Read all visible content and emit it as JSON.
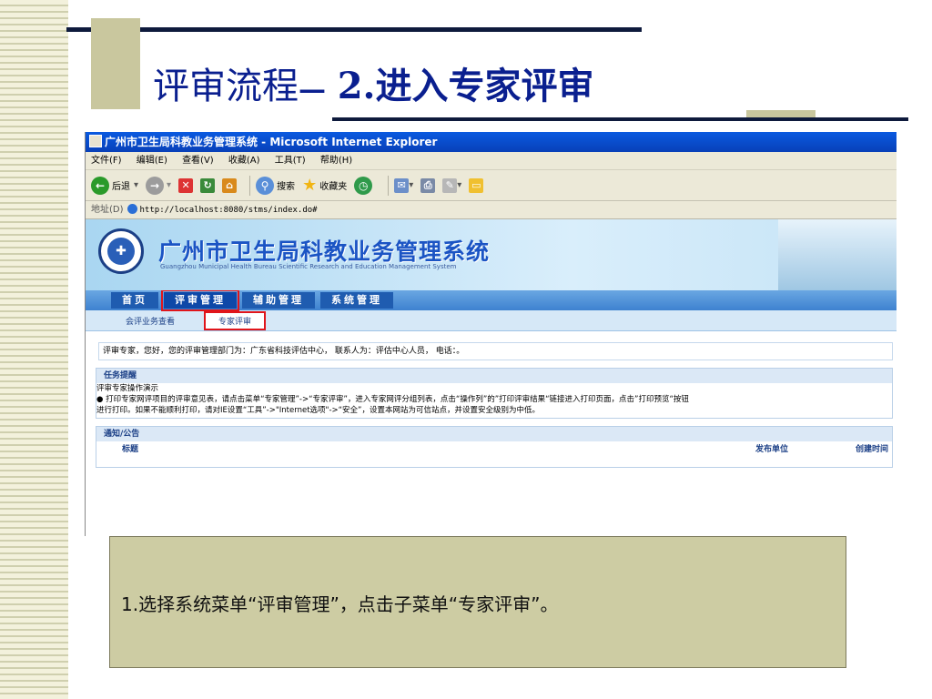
{
  "slide": {
    "title_main": "评审流程",
    "title_dash": "—",
    "title_step": "2.进入专家评审",
    "caption": "1.选择系统菜单“评审管理”，点击子菜单“专家评审”。"
  },
  "browser": {
    "window_title": "广州市卫生局科教业务管理系统 - Microsoft Internet Explorer",
    "menu": [
      "文件(F)",
      "编辑(E)",
      "查看(V)",
      "收藏(A)",
      "工具(T)",
      "帮助(H)"
    ],
    "toolbar": {
      "back": "后退",
      "search": "搜索",
      "favorites": "收藏夹"
    },
    "address_label": "地址(D)",
    "address_url": "http://localhost:8080/stms/index.do#"
  },
  "site": {
    "title": "广州市卫生局科教业务管理系统",
    "subtitle": "Guangzhou Municipal Health Bureau Scientific Research and Education Management System",
    "nav": [
      "首页",
      "评审管理",
      "辅助管理",
      "系统管理"
    ],
    "subnav": [
      "会评业务查看",
      "专家评审"
    ],
    "welcome": "评审专家，您好，您的评审管理部门为：广东省科技评估中心， 联系人为：评估中心人员， 电话：。",
    "task_panel": {
      "title": "任务提醒",
      "line1": "评审专家操作演示",
      "line2": "● 打印专家网评项目的评审意见表，请点击菜单“专家管理”->“专家评审”，进入专家网评分组列表，点击“操作列”的”打印评审结果“链接进入打印页面，点击”打印预览“按钮",
      "line3": "进行打印。如果不能顺利打印，请对IE设置“工具”->\"Internet选项\"->“安全”，设置本网站为可信站点，并设置安全级别为中低。"
    },
    "notice_panel": {
      "title": "通知/公告",
      "col_title": "标题",
      "col_org": "发布单位",
      "col_time": "创建时间"
    }
  },
  "colors": {
    "title_blue": "#0a1f8f",
    "highlight_red": "#e0151b",
    "caption_bg": "#cdcca3"
  }
}
